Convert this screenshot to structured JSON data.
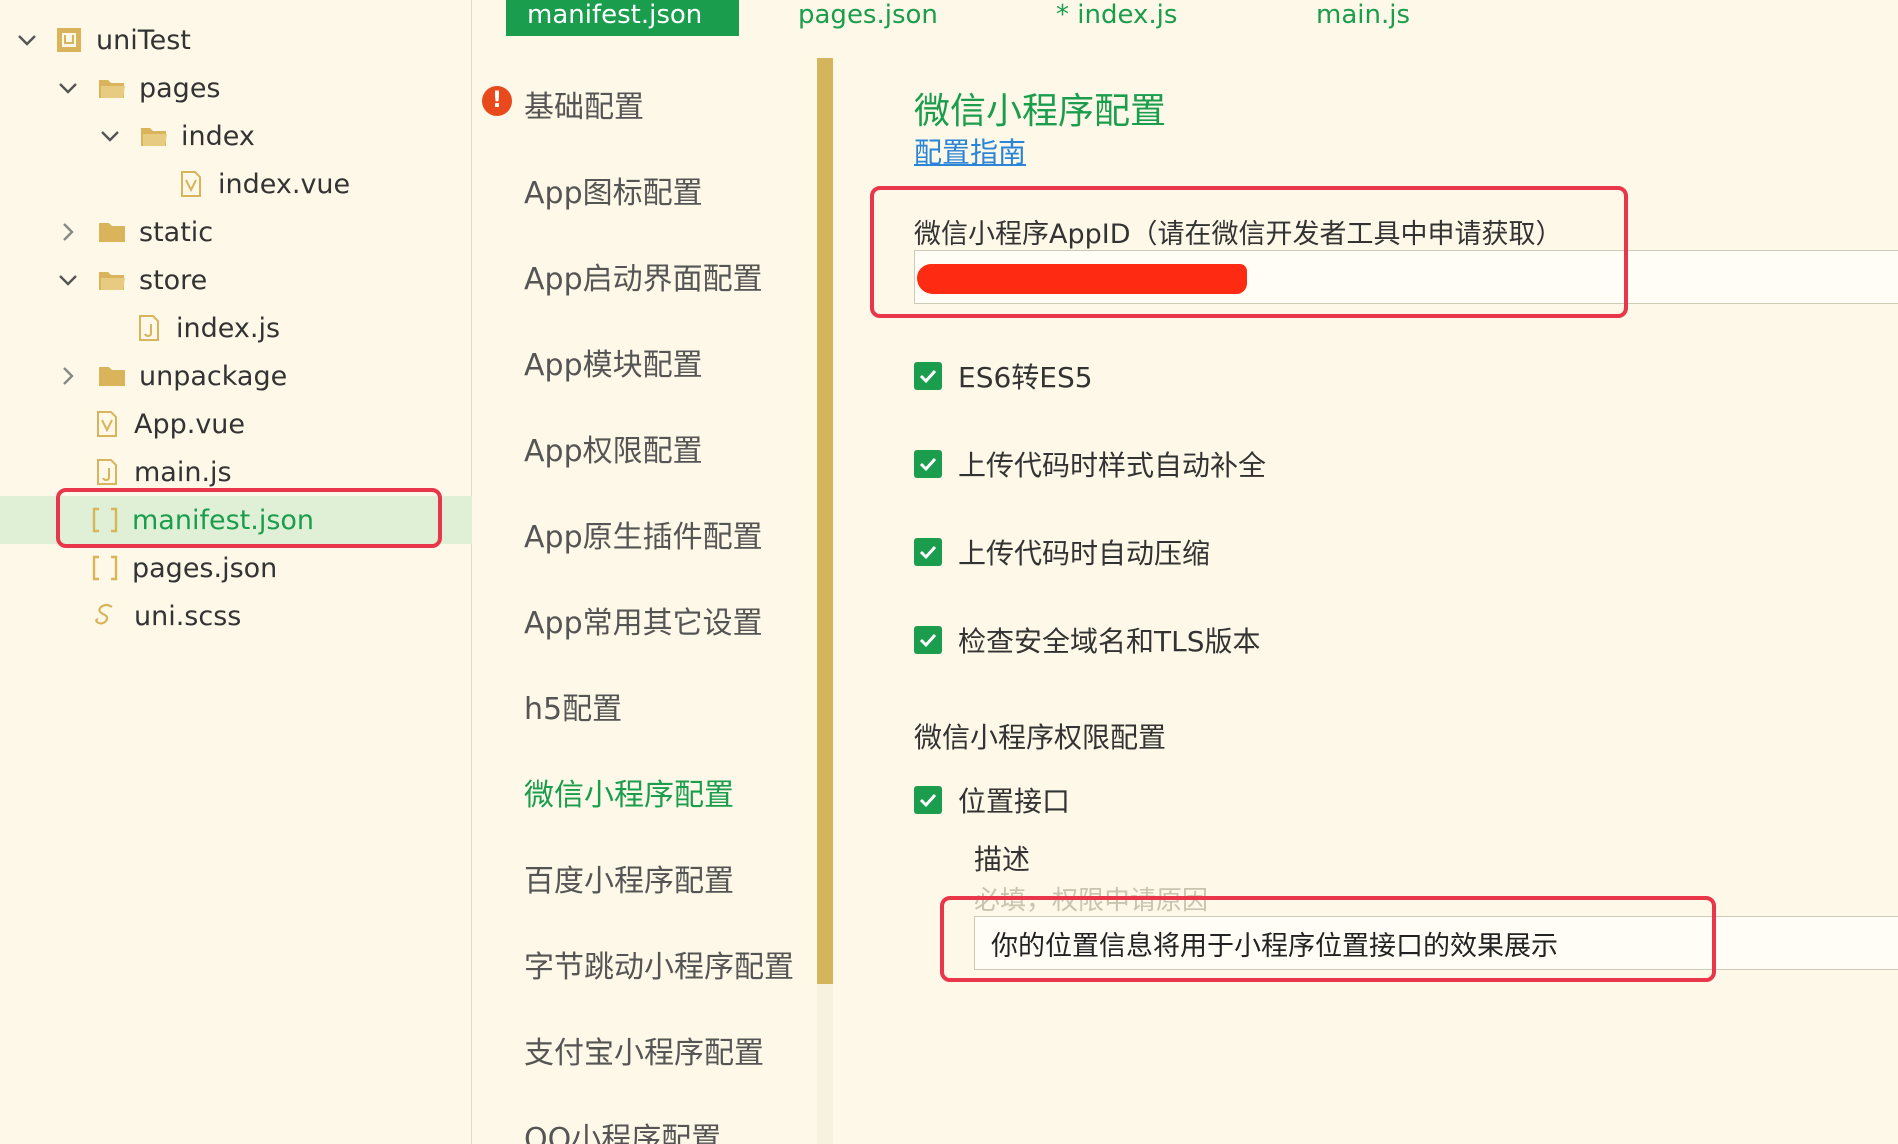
{
  "tabs": [
    {
      "label": "manifest.json",
      "active": true
    },
    {
      "label": "pages.json",
      "active": false
    },
    {
      "label": "* index.js",
      "active": false
    },
    {
      "label": "main.js",
      "active": false
    }
  ],
  "tree": [
    {
      "label": "uniTest",
      "icon": "project-icon",
      "chevron": "down"
    },
    {
      "label": "pages",
      "icon": "folder-open-icon",
      "chevron": "down"
    },
    {
      "label": "index",
      "icon": "folder-open-icon",
      "chevron": "down"
    },
    {
      "label": "index.vue",
      "icon": "vue-file-icon",
      "chevron": ""
    },
    {
      "label": "static",
      "icon": "folder-icon",
      "chevron": "right"
    },
    {
      "label": "store",
      "icon": "folder-open-icon",
      "chevron": "down"
    },
    {
      "label": "index.js",
      "icon": "js-file-icon",
      "chevron": ""
    },
    {
      "label": "unpackage",
      "icon": "folder-icon",
      "chevron": "right"
    },
    {
      "label": "App.vue",
      "icon": "vue-file-icon",
      "chevron": ""
    },
    {
      "label": "main.js",
      "icon": "js-file-icon",
      "chevron": ""
    },
    {
      "label": "manifest.json",
      "icon": "json-file-icon",
      "chevron": "",
      "selected": true
    },
    {
      "label": "pages.json",
      "icon": "json-file-icon",
      "chevron": ""
    },
    {
      "label": "uni.scss",
      "icon": "scss-file-icon",
      "chevron": ""
    }
  ],
  "nav": [
    {
      "label": "基础配置",
      "warning": true
    },
    {
      "label": "App图标配置"
    },
    {
      "label": "App启动界面配置"
    },
    {
      "label": "App模块配置"
    },
    {
      "label": "App权限配置"
    },
    {
      "label": "App原生插件配置"
    },
    {
      "label": "App常用其它设置"
    },
    {
      "label": "h5配置"
    },
    {
      "label": "微信小程序配置",
      "active": true
    },
    {
      "label": "百度小程序配置"
    },
    {
      "label": "字节跳动小程序配置"
    },
    {
      "label": "支付宝小程序配置"
    },
    {
      "label": "QQ小程序配置"
    }
  ],
  "main": {
    "title": "微信小程序配置",
    "guide_link": "配置指南",
    "appid_label": "微信小程序AppID（请在微信开发者工具中申请获取）",
    "checkboxes": [
      {
        "label": "ES6转ES5",
        "checked": true
      },
      {
        "label": "上传代码时样式自动补全",
        "checked": true
      },
      {
        "label": "上传代码时自动压缩",
        "checked": true
      },
      {
        "label": "检查安全域名和TLS版本",
        "checked": true
      }
    ],
    "permission_title": "微信小程序权限配置",
    "location": {
      "label": "位置接口",
      "checked": true
    },
    "desc_label": "描述",
    "desc_placeholder": "必填，权限申请原因",
    "desc_value": "你的位置信息将用于小程序位置接口的效果展示"
  },
  "colors": {
    "background": "#fdf8e7",
    "accent_green": "#1a9d4d",
    "link_blue": "#2a84d8",
    "highlight_red": "#e8374a",
    "warning_orange": "#e8491d",
    "scrollbar_gold": "#d5b55c"
  }
}
